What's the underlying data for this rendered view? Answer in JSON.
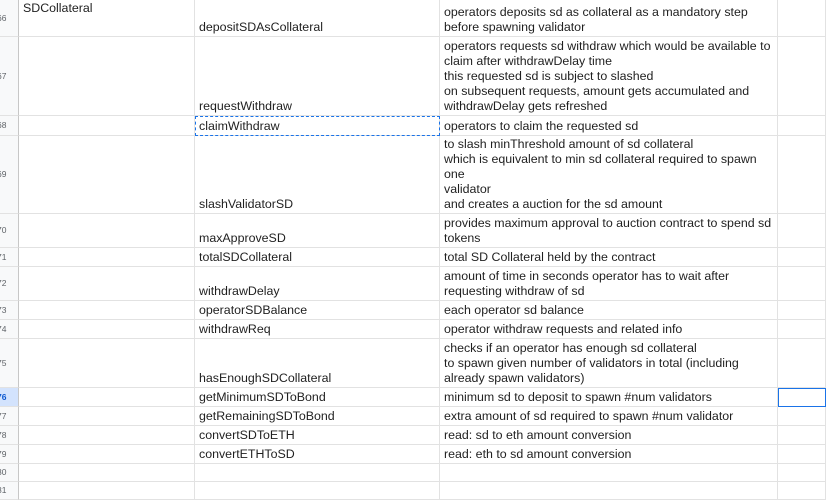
{
  "rows": [
    {
      "num": "66",
      "a": "SDCollateral",
      "b": "depositSDAsCollateral",
      "c": "operators deposits sd as collateral as a mandatory step\nbefore spawning validator"
    },
    {
      "num": "67",
      "a": "",
      "b": "requestWithdraw",
      "c": "operators requests sd withdraw which would be available to\nclaim after withdrawDelay time\nthis requested sd is subject to slashed\non subsequent requests, amount gets accumulated and\nwithdrawDelay gets refreshed"
    },
    {
      "num": "68",
      "a": "",
      "b": "claimWithdraw",
      "c": "operators to claim the requested sd"
    },
    {
      "num": "69",
      "a": "",
      "b": "slashValidatorSD",
      "c": "callable only by respective validatorWithdrawVaults\nto slash minThreshold amount of sd collateral\nwhich is equivalent to min sd collateral required to spawn one\nvalidator\nand creates a auction for the sd amount"
    },
    {
      "num": "70",
      "a": "",
      "b": "maxApproveSD",
      "c": "provides maximum approval to auction contract to spend sd\ntokens"
    },
    {
      "num": "71",
      "a": "",
      "b": "totalSDCollateral",
      "c": "total SD Collateral held by the contract"
    },
    {
      "num": "72",
      "a": "",
      "b": "withdrawDelay",
      "c": "amount of time in seconds operator has to wait after\nrequesting withdraw of sd"
    },
    {
      "num": "73",
      "a": "",
      "b": "operatorSDBalance",
      "c": "each operator sd balance"
    },
    {
      "num": "74",
      "a": "",
      "b": "withdrawReq",
      "c": "operator withdraw requests and related info"
    },
    {
      "num": "75",
      "a": "",
      "b": "hasEnoughSDCollateral",
      "c": "checks if an operator has enough sd collateral\nto spawn given number of validators in total (including\nalready spawn validators)"
    },
    {
      "num": "76",
      "a": "",
      "b": "getMinimumSDToBond",
      "c": "minimum sd to deposit to spawn #num validators"
    },
    {
      "num": "77",
      "a": "",
      "b": "getRemainingSDToBond",
      "c": "extra amount of sd required to spawn #num validator"
    },
    {
      "num": "78",
      "a": "",
      "b": "convertSDToETH",
      "c": "read: sd to eth amount conversion"
    },
    {
      "num": "79",
      "a": "",
      "b": "convertETHToSD",
      "c": "read: eth to sd amount conversion"
    },
    {
      "num": "80",
      "a": "",
      "b": "",
      "c": ""
    },
    {
      "num": "81",
      "a": "",
      "b": "",
      "c": ""
    }
  ]
}
